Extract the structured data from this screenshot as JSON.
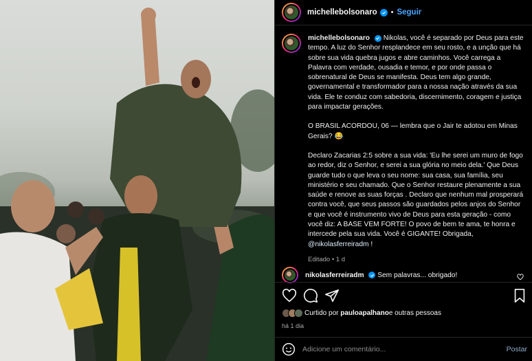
{
  "post_image": {
    "description_icon": "protest-photo"
  },
  "header": {
    "username": "michellebolsonaro",
    "separator": "•",
    "follow_label": "Seguir",
    "more_label": "···"
  },
  "caption": {
    "username": "michellebolsonaro",
    "paragraphs": [
      "Nikolas, você é separado por Deus para este tempo. A luz do Senhor resplandece em seu rosto, e a unção que há sobre sua vida quebra jugos e abre caminhos. Você carrega a Palavra com verdade, ousadia e temor, e por onde passa o sobrenatural de Deus se manifesta. Deus tem algo grande, governamental e transformador para a nossa nação através da sua vida. Ele te conduz com sabedoria, discernimento, coragem e justiça para impactar gerações.",
      "O BRASIL ACORDOU, 06 — lembra que o Jair te adotou em Minas Gerais? 😂",
      "Declaro Zacarias 2:5 sobre a sua vida: 'Eu lhe serei um muro de fogo ao redor, diz o Senhor, e serei a sua glória no meio dela.' Que Deus guarde tudo o que leva o seu nome: sua casa, sua família, seu ministério e seu chamado. Que o Senhor restaure plenamente a sua saúde e renove as suas forças . Declaro que nenhum mal prosperará contra você, que seus passos são guardados pelos anjos do Senhor e que você é instrumento vivo de Deus para esta geração - como você diz: A BASE VEM FORTE! O povo de bem te ama, te honra e intercede pela sua vida. Você é GIGANTE! Obrigada,"
    ],
    "mention": "@nikolasferreiradm",
    "closing": " !",
    "edited": "Editado • 1 d"
  },
  "comment": {
    "username": "nikolasferreiradm",
    "text": "Sem palavras... obrigado!"
  },
  "likes": {
    "prefix": "Curtido por ",
    "user": "pauloapalhano",
    "suffix": " e outras pessoas"
  },
  "timestamp": "há 1 dia",
  "add_comment": {
    "placeholder": "Adicione um comentário...",
    "post_label": "Postar"
  },
  "colors": {
    "accent": "#0095f6",
    "follow": "#4aa5ff",
    "background": "#000000"
  }
}
